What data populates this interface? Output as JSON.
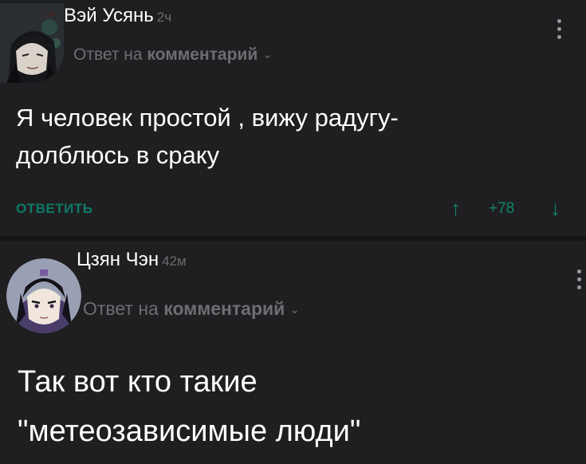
{
  "comments": [
    {
      "username": "Вэй Усянь",
      "timestamp": "2ч",
      "reply_prefix": "Ответ на ",
      "reply_target": "комментарий",
      "chevron": "⌄",
      "body_line1": "Я человек простой , вижу радугу-",
      "body_line2": "долблюсь в сраку",
      "reply_label": "ОТВЕТИТЬ",
      "vote_up": "↑",
      "score": "+78",
      "vote_down": "↓",
      "accent_color": "#12856f",
      "avatar_icon": "avatar-wei-wuxian"
    },
    {
      "username": "Цзян Чэн",
      "timestamp": "42м",
      "reply_prefix": "Ответ на ",
      "reply_target": "комментарий",
      "chevron": "⌄",
      "body_line1": "Так вот кто такие",
      "body_line2": "\"метеозависимые люди\"",
      "avatar_icon": "avatar-jiang-cheng"
    }
  ]
}
